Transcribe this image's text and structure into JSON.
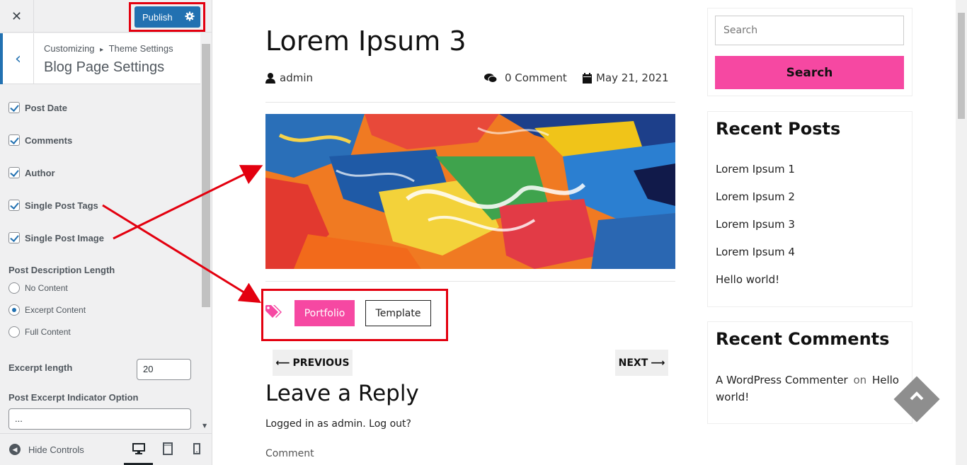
{
  "customizer": {
    "publish_label": "Publish",
    "breadcrumb_root": "Customizing",
    "breadcrumb_sep": "▸",
    "breadcrumb_section": "Theme Settings",
    "section_title": "Blog Page Settings",
    "checkboxes": [
      {
        "label": "Post Date",
        "checked": true
      },
      {
        "label": "Comments",
        "checked": true
      },
      {
        "label": "Author",
        "checked": true
      },
      {
        "label": "Single Post Tags",
        "checked": true
      },
      {
        "label": "Single Post Image",
        "checked": true
      }
    ],
    "desc_length_title": "Post Description Length",
    "desc_length_options": [
      {
        "label": "No Content",
        "selected": false
      },
      {
        "label": "Excerpt Content",
        "selected": true
      },
      {
        "label": "Full Content",
        "selected": false
      }
    ],
    "excerpt_length_label": "Excerpt length",
    "excerpt_length_value": "20",
    "excerpt_indicator_label": "Post Excerpt Indicator Option",
    "excerpt_indicator_value": "...",
    "hide_controls_label": "Hide Controls",
    "accent_color": "#2271b1"
  },
  "post": {
    "title": "Lorem Ipsum 3",
    "author": "admin",
    "comments": "0 Comment",
    "date": "May 21, 2021",
    "tags": [
      "Portfolio",
      "Template"
    ],
    "prev_label": "PREVIOUS",
    "next_label": "NEXT",
    "reply_heading": "Leave a Reply",
    "logged_in_text": "Logged in as admin. Log out?",
    "comment_label": "Comment"
  },
  "sidebar_widgets": {
    "search_placeholder": "Search",
    "search_button": "Search",
    "recent_posts_title": "Recent Posts",
    "recent_posts": [
      "Lorem Ipsum 1",
      "Lorem Ipsum 2",
      "Lorem Ipsum 3",
      "Lorem Ipsum 4",
      "Hello world!"
    ],
    "recent_comments_title": "Recent Comments",
    "recent_comment_author": "A WordPress Commenter",
    "recent_comment_on": "on",
    "recent_comment_post": "Hello world!"
  },
  "colors": {
    "brand_pink": "#f648a2",
    "annotation_red": "#e3000f"
  }
}
